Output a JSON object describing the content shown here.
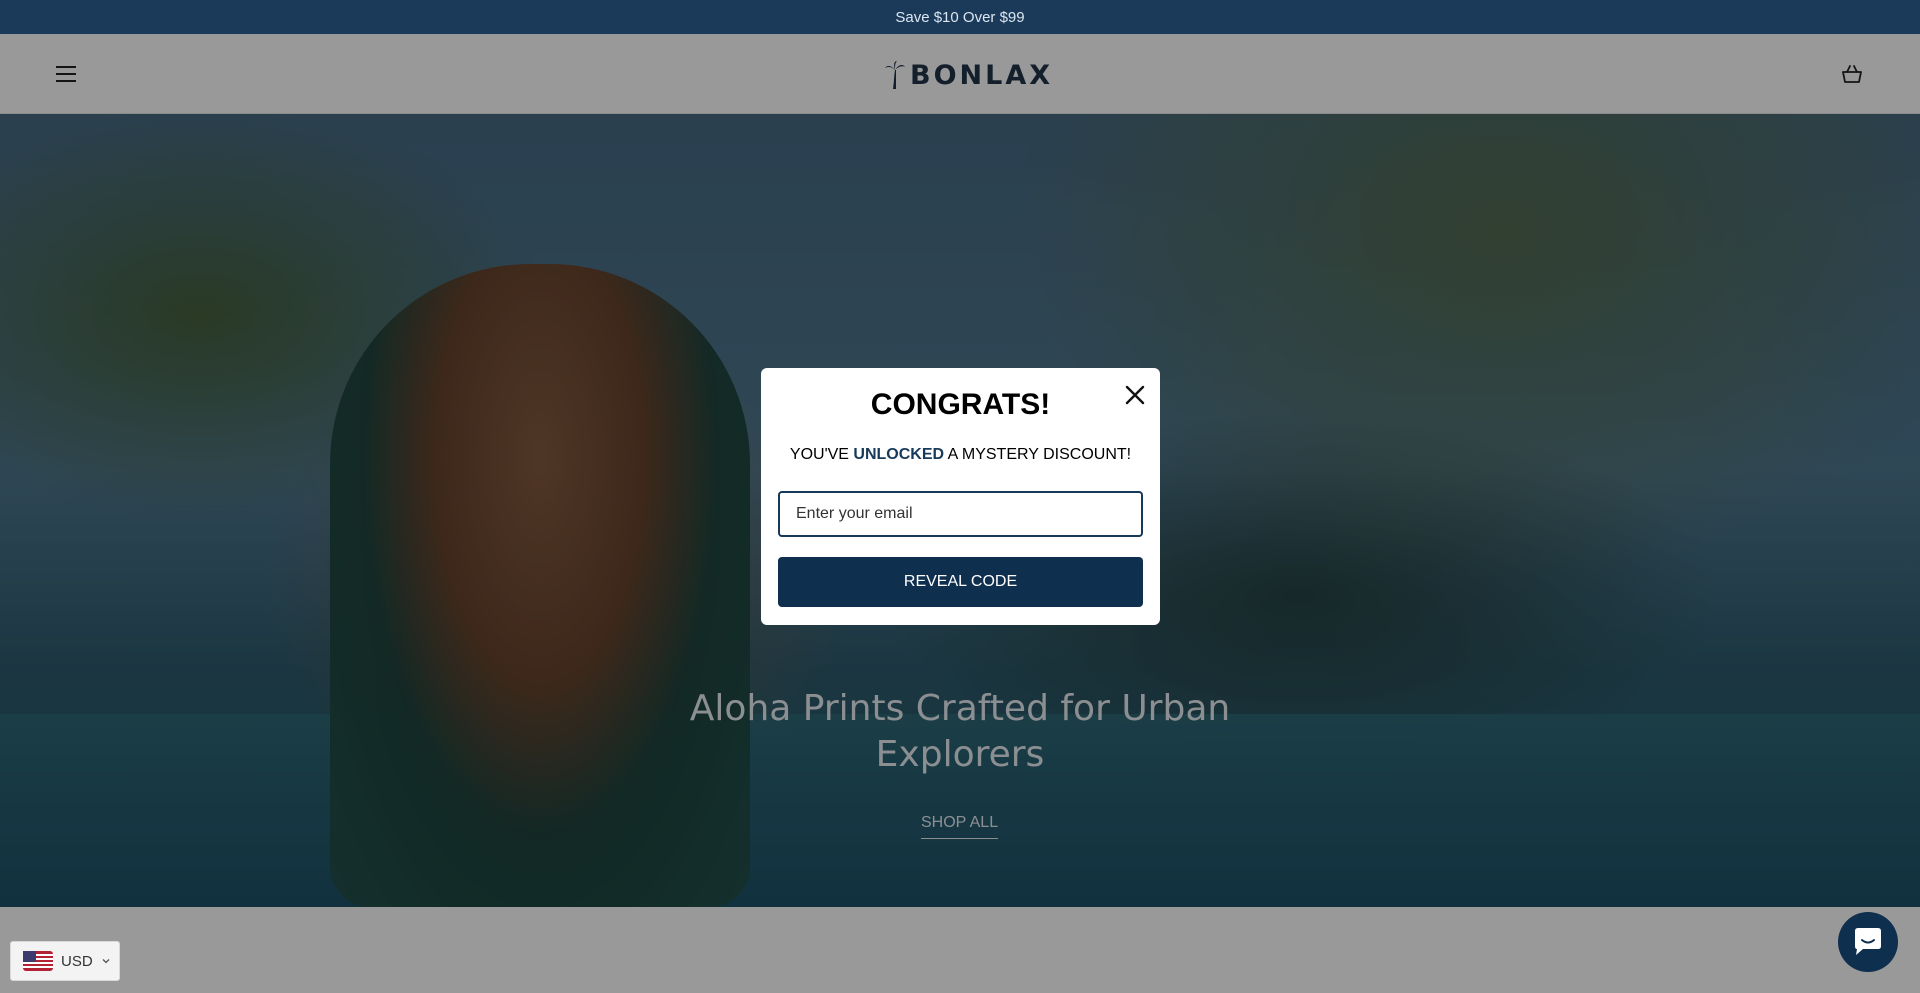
{
  "announcement": {
    "text": "Save $10 Over $99"
  },
  "header": {
    "logo_text": "BONLAX",
    "menu_icon": "hamburger-menu-icon",
    "cart_icon": "shopping-basket-icon"
  },
  "hero": {
    "title": "Aloha Prints Crafted for Urban Explorers",
    "cta_label": "SHOP ALL"
  },
  "popup": {
    "title": "CONGRATS!",
    "subtitle_pre": "YOU'VE ",
    "subtitle_highlight": "UNLOCKED",
    "subtitle_post": " A MYSTERY DISCOUNT!",
    "email_placeholder": "Enter your email",
    "email_value": "",
    "button_label": "REVEAL CODE",
    "close_icon": "close-icon"
  },
  "currency": {
    "label": "USD",
    "flag_icon": "us-flag-icon"
  },
  "chat": {
    "icon": "chat-icon"
  },
  "colors": {
    "announcement_bg": "#1b3a5a",
    "brand_navy": "#0f2f4f",
    "highlight": "#163a5a"
  }
}
